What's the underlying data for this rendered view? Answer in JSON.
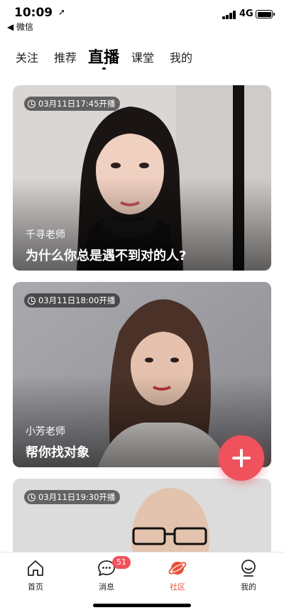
{
  "status_bar": {
    "time": "10:09",
    "location_glyph": "➚",
    "back_label": "◀ 微信",
    "network": "4G"
  },
  "tabs": [
    {
      "label": "关注",
      "active": false
    },
    {
      "label": "推荐",
      "active": false
    },
    {
      "label": "直播",
      "active": true
    },
    {
      "label": "课堂",
      "active": false
    },
    {
      "label": "我的",
      "active": false
    }
  ],
  "cards": [
    {
      "time": "03月11日17:45开播",
      "teacher": "千寻老师",
      "title": "为什么你总是遇不到对的人?"
    },
    {
      "time": "03月11日18:00开播",
      "teacher": "小芳老师",
      "title": "帮你找对象"
    },
    {
      "time": "03月11日19:30开播"
    }
  ],
  "fab": {
    "icon": "plus-icon",
    "color": "#f0525d"
  },
  "bottom_nav": {
    "items": [
      {
        "label": "首页",
        "icon": "home-icon",
        "active": false
      },
      {
        "label": "消息",
        "icon": "message-icon",
        "active": false
      },
      {
        "label": "社区",
        "icon": "planet-icon",
        "active": true
      },
      {
        "label": "我的",
        "icon": "profile-icon",
        "active": false
      }
    ],
    "message_badge": "51"
  },
  "colors": {
    "accent": "#f0525d",
    "active_nav": "#e8513a"
  }
}
